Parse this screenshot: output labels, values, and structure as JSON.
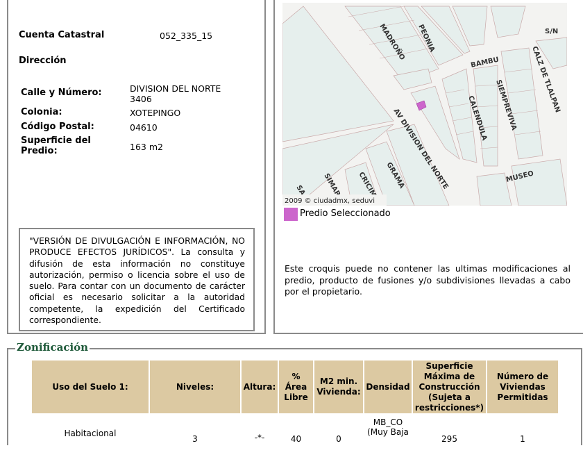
{
  "info": {
    "cuenta_label": "Cuenta Catastral",
    "cuenta_value": "052_335_15",
    "direccion_label": "Dirección",
    "calle_label": "Calle y Número:",
    "calle_value_1": "DIVISION DEL NORTE",
    "calle_value_2": "3406",
    "colonia_label": "Colonia:",
    "colonia_value": "XOTEPINGO",
    "cp_label": "Código Postal:",
    "cp_value": "04610",
    "superficie_label_1": "Superficie del",
    "superficie_label_2": "Predio:",
    "superficie_value": "163 m2"
  },
  "disclaimer": "\"VERSIÓN DE DIVULGACIÓN E INFORMACIÓN, NO PRODUCE EFECTOS JURÍDICOS\". La consulta y difusión de esta información no constituye autorización, permiso o licencia sobre el uso de suelo. Para contar con un documento de carácter oficial es necesario solicitar a la autoridad competente, la expedición del Certificado correspondiente.",
  "map": {
    "streets": {
      "madrono": "MADROÑO",
      "peonia": "PEONIA",
      "sn": "S/N",
      "bambu": "BAMBU",
      "calz": "CALZ DE TLALPAN",
      "calendula": "CALENDULA",
      "siempreviva": "SIEMPREVIVA",
      "division": "AV DIVISION DEL NORTE",
      "museo": "MUSEO",
      "grama": "GRAMA",
      "cricim": "CRICIM",
      "simar": "SIMAR",
      "sa": "SA"
    },
    "copyright": "2009 © ciudadmx, seduvi",
    "selected_color": "#cc66cc",
    "legend": "Predio Seleccionado",
    "note": "Este croquis puede no contener las ultimas modificaciones al predio, producto de fusiones y/o subdivisiones llevadas a cabo por el propietario."
  },
  "zonificacion": {
    "title": "Zonificación",
    "headers": {
      "uso": "Uso del Suelo 1:",
      "niveles": "Niveles:",
      "altura": "Altura:",
      "area_1": "%",
      "area_2": "Área",
      "area_3": "Libre",
      "m2_1": "M2 min.",
      "m2_2": "Vivienda:",
      "densidad": "Densidad",
      "sup_1": "Superficie",
      "sup_2": "Máxima de",
      "sup_3": "Construcción",
      "sup_4": "(Sujeta a",
      "sup_5": "restricciones*)",
      "num_1": "Número de",
      "num_2": "Viviendas",
      "num_3": "Permitidas"
    },
    "row": {
      "uso": "Habitacional",
      "niveles": "3",
      "altura": "-*-",
      "area_libre": "40",
      "m2_min": "0",
      "densidad_1": "MB_CO",
      "densidad_2": "(Muy Baja",
      "superficie": "295",
      "viviendas": "1"
    }
  }
}
